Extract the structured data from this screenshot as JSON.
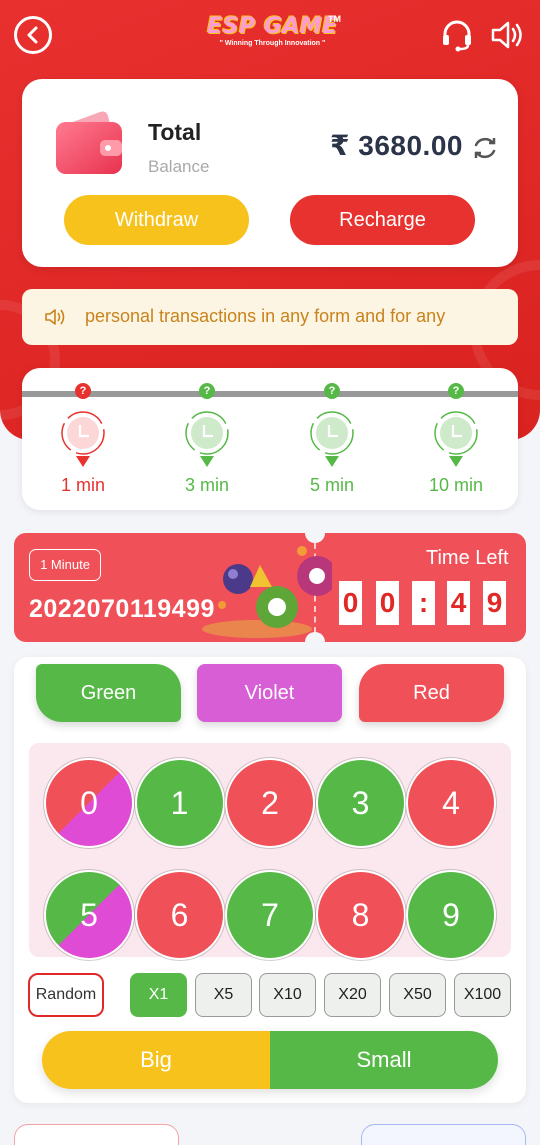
{
  "header": {
    "logo_text": "ESP GAME",
    "logo_tm": "TM",
    "logo_tagline": "\" Winning Through Innovation \"",
    "back_icon": "chevron-left-circle-icon",
    "support_icon": "headset-icon",
    "sound_icon": "speaker-icon"
  },
  "wallet": {
    "title": "Total",
    "subtitle": "Balance",
    "balance": "₹ 3680.00",
    "withdraw_label": "Withdraw",
    "recharge_label": "Recharge"
  },
  "notice": {
    "text": "personal transactions in any form and for any"
  },
  "timers": [
    {
      "label": "1 min",
      "active": true
    },
    {
      "label": "3 min",
      "active": false
    },
    {
      "label": "5 min",
      "active": false
    },
    {
      "label": "10 min",
      "active": false
    }
  ],
  "round": {
    "duration_badge": "1 Minute",
    "period": "2022070119499",
    "time_left_label": "Time Left",
    "digits": [
      "0",
      "0",
      ":",
      "4",
      "9"
    ]
  },
  "colors": {
    "green_label": "Green",
    "violet_label": "Violet",
    "red_label": "Red",
    "green": "#56b947",
    "violet": "#d85ed6",
    "red": "#f05057",
    "accent": "#e02827",
    "yellow": "#f7c21c"
  },
  "numbers": [
    "0",
    "1",
    "2",
    "3",
    "4",
    "5",
    "6",
    "7",
    "8",
    "9"
  ],
  "multipliers": {
    "random_label": "Random",
    "options": [
      "X1",
      "X5",
      "X10",
      "X20",
      "X50",
      "X100"
    ],
    "selected": "X1"
  },
  "size": {
    "big_label": "Big",
    "small_label": "Small"
  }
}
